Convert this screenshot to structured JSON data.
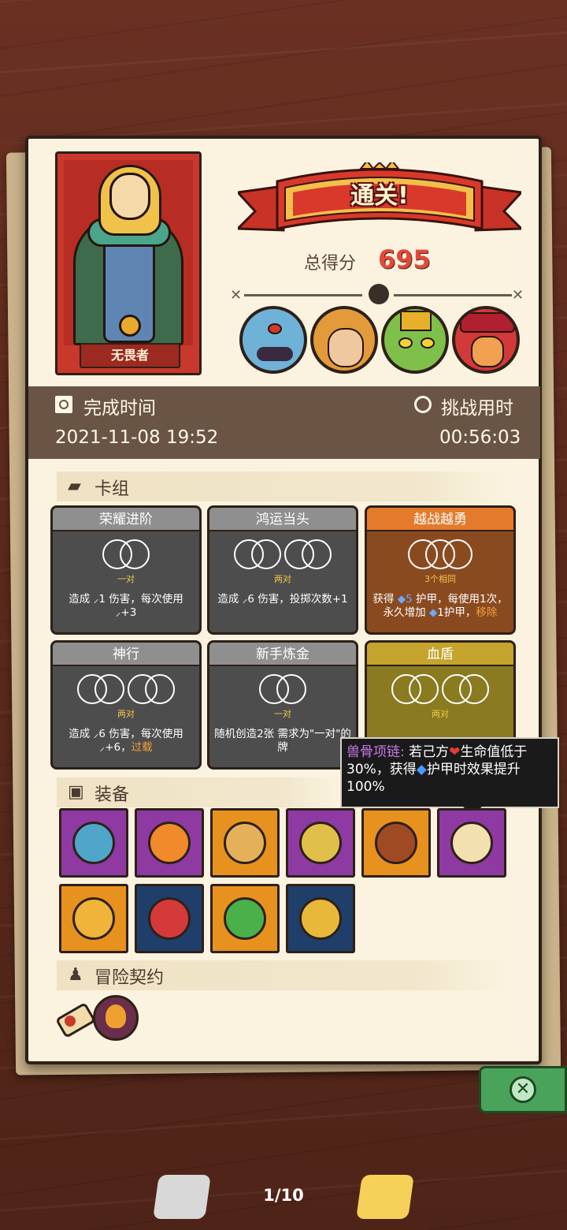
{
  "hero": {
    "name": "无畏者"
  },
  "result": {
    "banner": "通关!",
    "score_label": "总得分",
    "score_value": "695"
  },
  "stats": {
    "finish_label": "完成时间",
    "finish_value": "2021-11-08 19:52",
    "challenge_label": "挑战用时",
    "challenge_value": "00:56:03"
  },
  "deck": {
    "title": "卡组",
    "cards": [
      {
        "title": "荣耀进阶",
        "sub": "一对",
        "desc": "造成 ⸝1 伤害，每次使用 ⸝+3"
      },
      {
        "title": "鸿运当头",
        "sub": "两对",
        "desc": "造成 ⸝6 伤害，投掷次数+1"
      },
      {
        "title": "越战越勇",
        "sub": "3个相同",
        "desc_a": "获得 ",
        "desc_b": "5",
        "desc_c": " 护甲，每使用1次，永久增加 ",
        "desc_d": "1护甲，",
        "desc_e": "移除"
      },
      {
        "title": "神行",
        "sub": "两对",
        "desc_a": "造成 ⸝6 伤害，每次使用 ⸝+6，",
        "desc_b": "过载"
      },
      {
        "title": "新手炼金",
        "sub": "一对",
        "desc": "随机创造2张 需求为\"一对\"的牌"
      },
      {
        "title": "血盾",
        "sub": "两对",
        "desc": ""
      }
    ]
  },
  "tooltip": {
    "name": "兽骨项链:",
    "text_a": " 若己方",
    "text_b": "生命值低于30%，获得",
    "text_c": "护甲时效果提升100%"
  },
  "equipment": {
    "title": "装备"
  },
  "contracts": {
    "title": "冒险契约"
  },
  "pager": {
    "text": "1/10"
  },
  "colors": {
    "score": "#e04a3a",
    "purple": "#8e3aa2",
    "orange": "#e7921f",
    "navy": "#1f3f6a"
  }
}
